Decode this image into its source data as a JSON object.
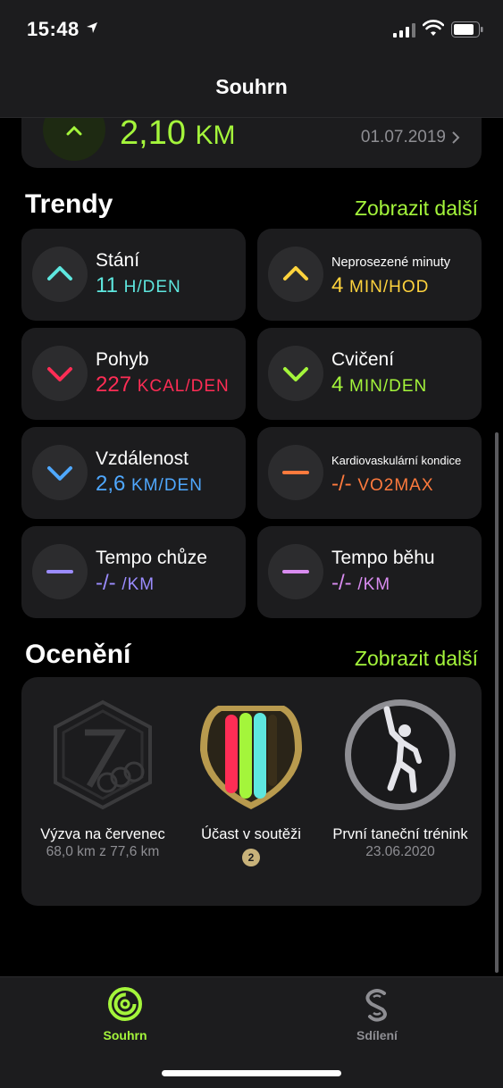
{
  "status_bar": {
    "time": "15:48"
  },
  "nav": {
    "title": "Souhrn"
  },
  "top_card": {
    "value": "2,10",
    "unit": "KM",
    "date": "01.07.2019"
  },
  "trends": {
    "title": "Trendy",
    "more": "Zobrazit další",
    "items": [
      {
        "label": "Stání",
        "value": "11",
        "unit": "H/DEN",
        "color": "#5ee7df",
        "direction": "up"
      },
      {
        "label": "Neprosezené minuty",
        "value": "4",
        "unit": "MIN/HOD",
        "color": "#ffd33d",
        "direction": "up"
      },
      {
        "label": "Pohyb",
        "value": "227",
        "unit": "KCAL/DEN",
        "color": "#ff2d55",
        "direction": "down"
      },
      {
        "label": "Cvičení",
        "value": "4",
        "unit": "MIN/DEN",
        "color": "#a4f53b",
        "direction": "down"
      },
      {
        "label": "Vzdálenost",
        "value": "2,6",
        "unit": "KM/DEN",
        "color": "#4fa8ff",
        "direction": "down"
      },
      {
        "label": "Kardiovaskulární kondice",
        "value": "-/-",
        "unit": "VO2MAX",
        "color": "#ff7a3d",
        "direction": "flat"
      },
      {
        "label": "Tempo chůze",
        "value": "-/-",
        "unit": "/KM",
        "color": "#9b8cff",
        "direction": "flat"
      },
      {
        "label": "Tempo běhu",
        "value": "-/-",
        "unit": "/KM",
        "color": "#d98cf0",
        "direction": "flat"
      }
    ]
  },
  "awards": {
    "title": "Ocenění",
    "more": "Zobrazit další",
    "items": [
      {
        "name": "Výzva na červenec",
        "sub": "68,0 km z 77,6 km",
        "icon": "hexagon-challenge-icon"
      },
      {
        "name": "Účast v soutěži",
        "count": "2",
        "icon": "competition-shield-icon"
      },
      {
        "name": "První taneční trénink",
        "sub": "23.06.2020",
        "icon": "dance-figure-icon"
      }
    ]
  },
  "tabbar": {
    "items": [
      {
        "label": "Souhrn",
        "color": "#a4f53b",
        "icon": "activity-rings-icon"
      },
      {
        "label": "Sdílení",
        "color": "#8e8e93",
        "icon": "sharing-icon"
      }
    ]
  }
}
